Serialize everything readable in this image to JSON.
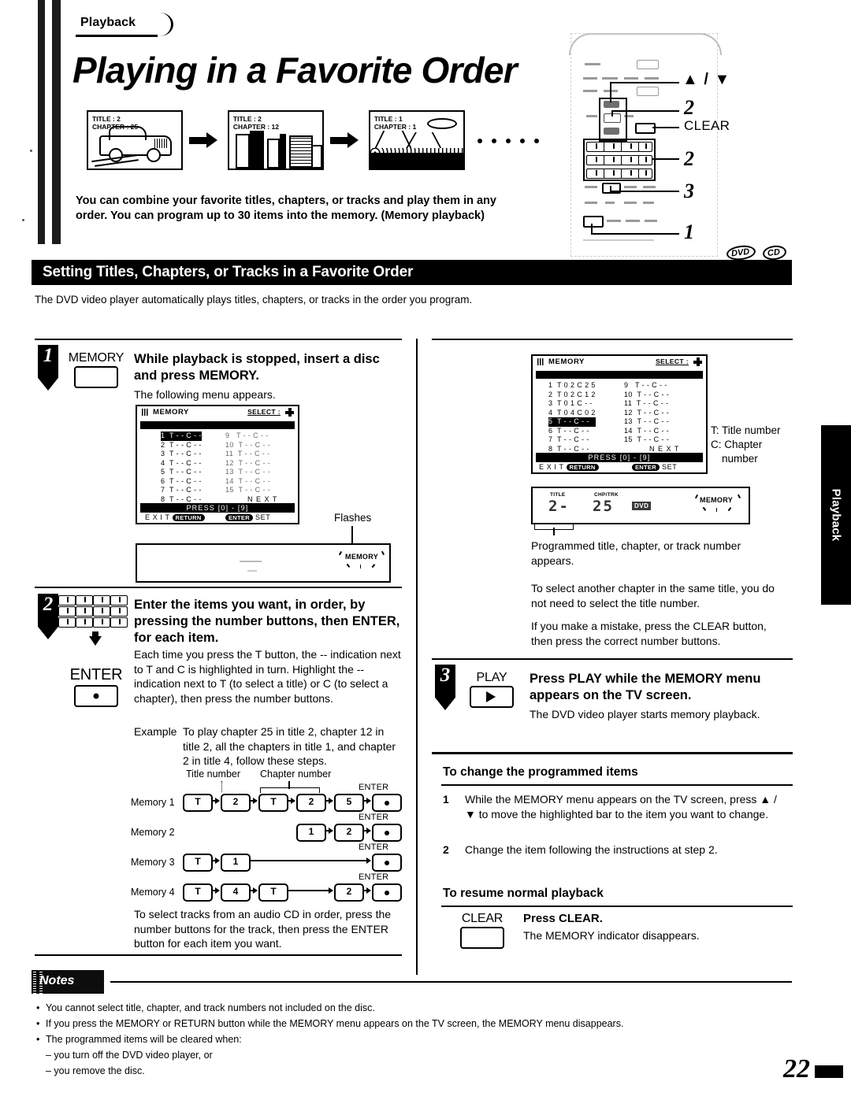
{
  "tab": {
    "label": "Playback"
  },
  "header": {
    "kicker": "Playback",
    "title": "Playing in a Favorite Order"
  },
  "thumbnails": [
    {
      "title_label": "TITLE : 2",
      "chapter_label": "CHAPTER : 25",
      "art": "car"
    },
    {
      "title_label": "TITLE : 2",
      "chapter_label": "CHAPTER : 12",
      "art": "city"
    },
    {
      "title_label": "TITLE : 1",
      "chapter_label": "CHAPTER : 1",
      "art": "mountain"
    }
  ],
  "intro": "You can combine your favorite titles, chapters, or tracks and play them in any order. You can program up to 30 items into the memory. (Memory playback)",
  "remote": {
    "callouts": {
      "updown": "▲ / ▼",
      "nav": "2",
      "clear": "CLEAR",
      "numbers": "2",
      "play": "3",
      "memory": "1"
    },
    "badges": [
      "DVD",
      "CD"
    ]
  },
  "section": {
    "header": "Setting Titles, Chapters, or Tracks in a Favorite Order",
    "subtext": "The DVD video player automatically plays titles, chapters, or tracks in the order you program."
  },
  "steps": [
    {
      "num": "1",
      "button_caption": "MEMORY",
      "title": "While playback is stopped, insert a disc and press MEMORY.",
      "body": "The following menu appears.",
      "flashes_label": "Flashes",
      "panel_indicator": "MEMORY"
    },
    {
      "num": "2",
      "button_caption": "ENTER",
      "title": "Enter the items you want, in order, by pressing the number buttons, then ENTER, for each item.",
      "body": "Each time you press the T button, the -- indication next to T and C is highlighted in turn. Highlight the -- indication next to T (to select a title) or C (to select a chapter), then press the number buttons.",
      "example_label": "Example",
      "example_text": "To play chapter 25 in title 2, chapter 12 in title 2, all the chapters in title 1, and chapter 2 in title 4, follow these steps.",
      "footer_text": "To select tracks from an audio CD in order, press the number buttons for the track, then press the ENTER button for each item you want.",
      "keypad": [
        "1",
        "2",
        "3",
        "T",
        "4",
        "5",
        "6",
        "+10",
        "7",
        "8",
        "9",
        "0"
      ]
    },
    {
      "num": "3",
      "button_caption": "PLAY",
      "title": "Press PLAY while the MEMORY menu appears on the TV screen.",
      "body": "The DVD video player starts memory playback."
    }
  ],
  "osd_left": {
    "title": "MEMORY",
    "select_label": "SELECT :",
    "rows": [
      "1  T - - C - -",
      "2  T - - C - -",
      "3  T - - C - -",
      "4  T - - C - -",
      "5  T - - C - -",
      "6  T - - C - -",
      "7  T - - C - -",
      "8  T - - C - -"
    ],
    "rows_right": [
      "9   T - - C - -",
      "10  T - - C - -",
      "11  T - - C - -",
      "12  T - - C - -",
      "13  T - - C - -",
      "14  T - - C - -",
      "15  T - - C - -"
    ],
    "next": "N E X T",
    "press_bar": "PRESS  [0] - [9]",
    "exit_label": "E X I T",
    "exit_key": "RETURN",
    "enter_key": "ENTER",
    "set_label": "SET",
    "highlight_row_index": 0
  },
  "osd_right": {
    "title": "MEMORY",
    "select_label": "SELECT :",
    "rows": [
      "1  T 0 2 C 2 5",
      "2  T 0 2 C 1 2",
      "3  T 0 1 C - -",
      "4  T 0 4 C 0 2",
      "5  T - - C - -",
      "6  T - - C - -",
      "7  T - - C - -",
      "8  T - - C - -"
    ],
    "rows_right": [
      "9   T - - C - -",
      "10  T - - C - -",
      "11  T - - C - -",
      "12  T - - C - -",
      "13  T - - C - -",
      "14  T - - C - -",
      "15  T - - C - -"
    ],
    "next": "N E X T",
    "press_bar": "PRESS  [0] - [9]",
    "exit_label": "E X I T",
    "exit_key": "RETURN",
    "enter_key": "ENTER",
    "set_label": "SET",
    "highlight_row_index": 4,
    "legend": [
      "T: Title number",
      "C: Chapter",
      "number"
    ]
  },
  "front_panel": {
    "title_label": "TITLE",
    "chp_label": "CHP/TRK",
    "title_value": "2-",
    "chp_value": "25",
    "badge": "DVD",
    "memory_indicator": "MEMORY",
    "caption": "Programmed title, chapter, or track number appears."
  },
  "right_notes": [
    "To select another chapter in the same title, you do not need to select the title number.",
    "If you make a mistake, press the CLEAR button, then press the correct number buttons."
  ],
  "sequence": {
    "title_number_label": "Title number",
    "chapter_number_label": "Chapter number",
    "enter_label": "ENTER",
    "rows": [
      {
        "label": "Memory 1",
        "keys": [
          "T",
          "2",
          "T",
          "2",
          "5"
        ]
      },
      {
        "label": "Memory 2",
        "keys": [
          "1",
          "2"
        ]
      },
      {
        "label": "Memory 3",
        "keys": [
          "T",
          "1"
        ]
      },
      {
        "label": "Memory 4",
        "keys": [
          "T",
          "4",
          "T",
          "2"
        ]
      }
    ]
  },
  "change_items": {
    "heading": "To change the programmed items",
    "items": [
      {
        "n": "1",
        "text": "While the MEMORY menu appears on the TV screen, press ▲ / ▼ to move the highlighted bar to the item you want to change."
      },
      {
        "n": "2",
        "text": "Change the item following the instructions at step 2."
      }
    ]
  },
  "resume": {
    "heading": "To resume normal playback",
    "button_caption": "CLEAR",
    "title": "Press CLEAR.",
    "body": "The MEMORY indicator disappears."
  },
  "notes": {
    "heading": "Notes",
    "items": [
      "You cannot select title, chapter, and track numbers not included on the disc.",
      "If you press the MEMORY or RETURN button while the MEMORY menu appears on the TV screen, the MEMORY menu disappears.",
      "The programmed items will be cleared when:"
    ],
    "subitems": [
      "– you turn off the DVD video player, or",
      "– you remove the disc."
    ]
  },
  "page_number": "22"
}
